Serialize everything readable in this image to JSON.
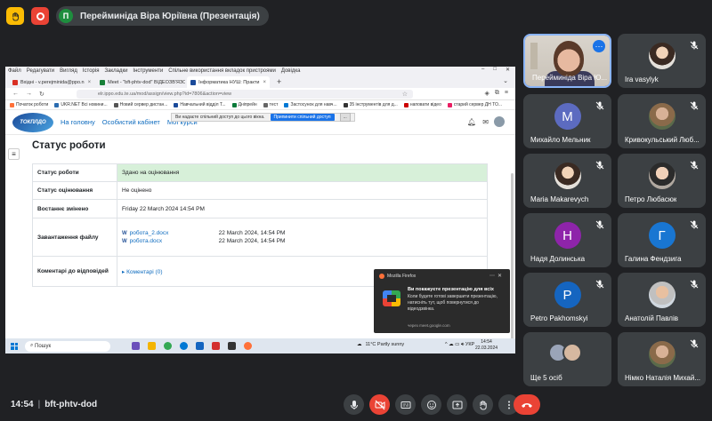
{
  "presenter_chip": {
    "initial": "П",
    "name": "Перейминіда Віра Юріївна (Презентація)"
  },
  "browser": {
    "menu": [
      "Файл",
      "Редагувати",
      "Вигляд",
      "Історія",
      "Закладки",
      "Інструменти",
      "Спільне використання вкладок пристроями",
      "Довідка"
    ],
    "tabs": [
      {
        "label": "Вхідні - v.perejminida@ppo.n",
        "color": "#d93025",
        "active": false
      },
      {
        "label": "Meet - \"bft-phtv-dod\" ВІДЕОЗВ'ЯЗОК",
        "color": "#188038",
        "active": false
      },
      {
        "label": "Інформатика НУШ: Практи",
        "color": "#1a4a9a",
        "active": true
      }
    ],
    "url": "elr.ippo.edu.te.ua/mod/assign/view.php?id=7806&action=view",
    "bookmarks": [
      {
        "label": "Початок роботи",
        "color": "#ff7139"
      },
      {
        "label": "UKR.NET Всі новини...",
        "color": "#2b6cb0"
      },
      {
        "label": "Новий сервер дистан...",
        "color": "#555"
      },
      {
        "label": "Навчальний відділ Т...",
        "color": "#1a4a9a"
      },
      {
        "label": "Дніпрейн",
        "color": "#0a7a3a"
      },
      {
        "label": "тест",
        "color": "#666"
      },
      {
        "label": "Застосунок для навч...",
        "color": "#0078d4"
      },
      {
        "label": "35 інструментів для д...",
        "color": "#333"
      },
      {
        "label": "наповати відео",
        "color": "#c00"
      },
      {
        "label": "старий сервер ДН ТО...",
        "color": "#e91e63"
      }
    ]
  },
  "site": {
    "logo": "ТОКПЛДО",
    "nav": [
      "На головну",
      "Особистий кабінет",
      "Мої курси"
    ],
    "share_notice": "Ви надаєте спільний доступ до цього вікна.",
    "share_button": "Припинити спільний доступ",
    "hide_button": "...",
    "page_title": "Статус роботи",
    "rows": [
      {
        "label": "Статус роботи",
        "value": "Здано на оцінювання"
      },
      {
        "label": "Статус оцінювання",
        "value": "Не оцінено"
      },
      {
        "label": "Востаннє змінено",
        "value": "Friday 22 March 2024 14:54 PM"
      },
      {
        "label": "Завантаження файлу"
      },
      {
        "label": "Коментарі до відповідей"
      }
    ],
    "files": [
      {
        "name": "робота_2.docx",
        "date": "22 March 2024, 14:54 PM"
      },
      {
        "name": "робота.docx",
        "date": "22 March 2024, 14:54 PM"
      }
    ],
    "comments_link": "Коментарі (0)"
  },
  "notification": {
    "app": "Mozilla Firefox",
    "title": "Ви покажуєте презентацію для всіх",
    "body": "Коли будете готові завершити презентацію, натисніть тут, щоб повернутися до відеодзвінка.",
    "via": "через meet.google.com"
  },
  "taskbar": {
    "search": "Пошук",
    "weather": "11°C  Partly sunny",
    "lang": "УКР",
    "time": "14:54",
    "date": "22.03.2024"
  },
  "tiles": [
    {
      "name": "Перейминіда Віра Ю...",
      "kind": "self"
    },
    {
      "name": "Ira vasylyk",
      "kind": "photo",
      "photo": "b"
    },
    {
      "name": "Михайло Мельник",
      "kind": "letter",
      "letter": "M",
      "color": "#5c6bc0"
    },
    {
      "name": "Кривокульський Люб...",
      "kind": "photo",
      "photo": "c"
    },
    {
      "name": "Maria Makarevych",
      "kind": "photo",
      "photo": "b"
    },
    {
      "name": "Петро Любасюк",
      "kind": "photo",
      "photo": "d"
    },
    {
      "name": "Надя Долинська",
      "kind": "letter",
      "letter": "Н",
      "color": "#8e24aa"
    },
    {
      "name": "Галина Фендзига",
      "kind": "letter",
      "letter": "Г",
      "color": "#1976d2"
    },
    {
      "name": "Petro Pakhomskyi",
      "kind": "letter",
      "letter": "P",
      "color": "#1565c0"
    },
    {
      "name": "Анатолій Павлів",
      "kind": "photo",
      "photo": "e"
    },
    {
      "name": "Ще 5 осіб",
      "kind": "more"
    },
    {
      "name": "Німко Наталія Михай...",
      "kind": "photo",
      "photo": "c"
    }
  ],
  "meeting": {
    "time": "14:54",
    "code": "bft-phtv-dod"
  },
  "colors": {
    "bg": "#202124",
    "tile": "#3c4043",
    "accent": "#8ab4f8",
    "danger": "#ea4335"
  }
}
